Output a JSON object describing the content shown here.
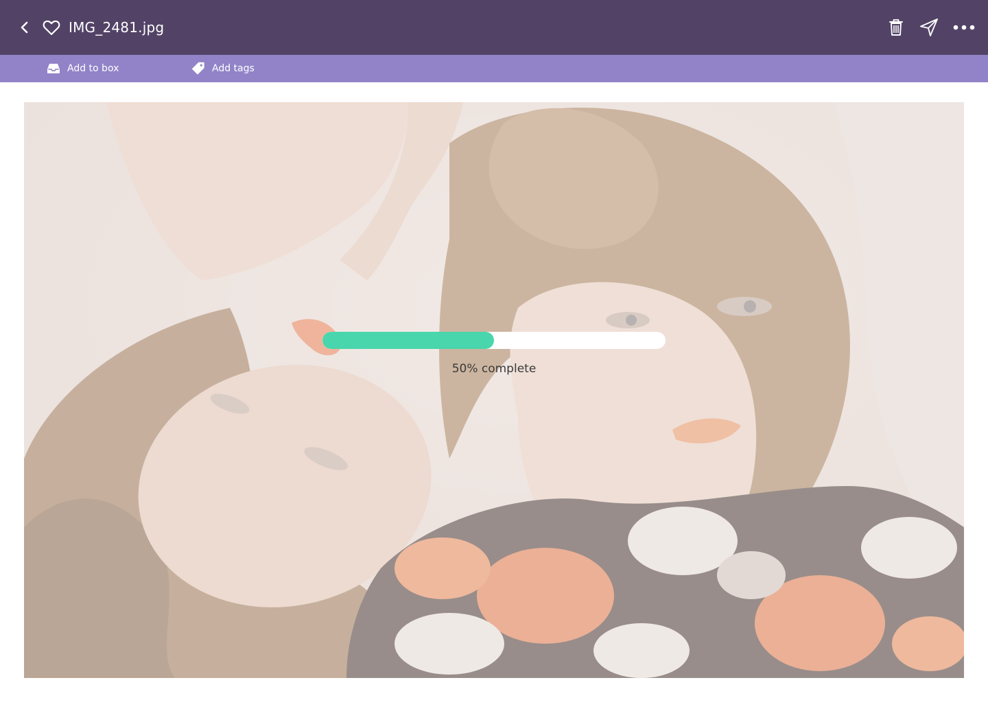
{
  "header": {
    "title": "IMG_2481.jpg",
    "back_icon": "chevron-left-icon",
    "favorite_icon": "heart-outline-icon",
    "trash_icon": "trash-icon",
    "send_icon": "send-icon",
    "more_icon": "more-horizontal-icon"
  },
  "toolbar": {
    "add_to_box_label": "Add to box",
    "add_to_box_icon": "inbox-tray-icon",
    "add_tags_label": "Add tags",
    "add_tags_icon": "tag-icon"
  },
  "upload": {
    "progress": 0.5,
    "label": "50% complete"
  },
  "colors": {
    "header_bg": "#524366",
    "toolbar_bg": "#9283c8",
    "progress_fill": "#49d6ac",
    "progress_track": "#ffffff"
  }
}
